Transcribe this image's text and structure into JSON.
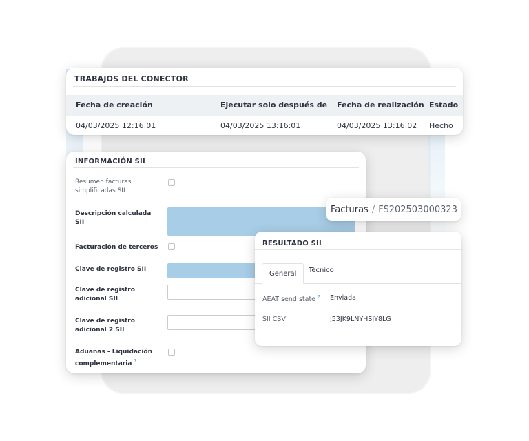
{
  "jobs": {
    "title": "TRABAJOS DEL CONECTOR",
    "columns": [
      "Fecha de creación",
      "Ejecutar solo después de",
      "Fecha de realización",
      "Estado"
    ],
    "rows": [
      [
        "04/03/2025 12:16:01",
        "04/03/2025 13:16:01",
        "04/03/2025 13:16:02",
        "Hecho"
      ]
    ]
  },
  "sii_info": {
    "title": "INFORMACIÓN SII",
    "fields": [
      {
        "label": "Resumen facturas simplificadas SII",
        "type": "checkbox",
        "checked": false
      },
      {
        "label": "Descripción calculada SII",
        "type": "textarea",
        "value": ""
      },
      {
        "label": "Facturación de terceros",
        "type": "checkbox",
        "checked": false
      },
      {
        "label": "Clave de registro SII",
        "type": "select",
        "value": ""
      },
      {
        "label": "Clave de registro adicional SII",
        "type": "select",
        "value": ""
      },
      {
        "label": "Clave de registro adicional 2 SII",
        "type": "select",
        "value": ""
      },
      {
        "label": "Aduanas - Liquidación complementaria",
        "type": "checkbox",
        "checked": false,
        "help": "?"
      }
    ]
  },
  "breadcrumb": {
    "parent": "Facturas",
    "separator": "/",
    "current": "FS202503000323"
  },
  "result": {
    "title": "RESULTADO SII",
    "tabs": [
      "General",
      "Técnico"
    ],
    "active_tab": "General",
    "rows": [
      {
        "label": "AEAT send state",
        "help": "?",
        "value": "Enviada"
      },
      {
        "label": "SII CSV",
        "value": "J53JK9LNYHSJY8LG"
      }
    ]
  },
  "colors": {
    "background_blob": "#eeeeee",
    "input_highlight": "#a8cde6",
    "table_header": "#eef1f4",
    "text": "#2f3340",
    "help_icon": "#4a90c8"
  },
  "icons": [
    "help-icon"
  ]
}
